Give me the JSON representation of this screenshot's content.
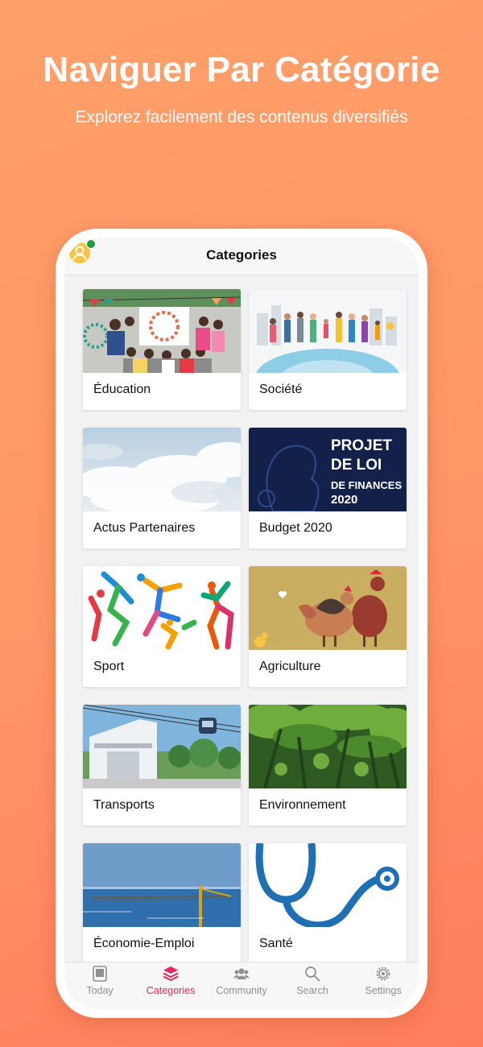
{
  "hero": {
    "title": "Naviguer Par Catégorie",
    "subtitle": "Explorez facilement des contenus diversifiés"
  },
  "navbar": {
    "title": "Categories",
    "avatar_icon": "user-avatar-icon",
    "status": "online"
  },
  "categories": [
    {
      "label": "Éducation",
      "image": "education-photo"
    },
    {
      "label": "Société",
      "image": "society-illustration"
    },
    {
      "label": "Actus Partenaires",
      "image": "sky-clouds-photo"
    },
    {
      "label": "Budget 2020",
      "image": "budget-cover",
      "image_text": [
        "PROJET",
        "DE LOI",
        "DE FINANCES",
        "2020"
      ]
    },
    {
      "label": "Sport",
      "image": "sport-illustration"
    },
    {
      "label": "Agriculture",
      "image": "chickens-illustration"
    },
    {
      "label": "Transports",
      "image": "cable-car-photo"
    },
    {
      "label": "Environnement",
      "image": "forest-photo"
    },
    {
      "label": "Économie-Emploi",
      "image": "sea-crane-photo"
    },
    {
      "label": "Santé",
      "image": "stethoscope-illustration"
    }
  ],
  "tabs": [
    {
      "label": "Today",
      "icon": "today-icon",
      "active": false
    },
    {
      "label": "Categories",
      "icon": "layers-icon",
      "active": true
    },
    {
      "label": "Community",
      "icon": "people-icon",
      "active": false
    },
    {
      "label": "Search",
      "icon": "search-icon",
      "active": false
    },
    {
      "label": "Settings",
      "icon": "gear-icon",
      "active": false
    }
  ],
  "colors": {
    "background": "#ff9566",
    "active_tab": "#e8265a",
    "inactive_tab": "#8e8e93",
    "status_dot": "#1e9b3a"
  }
}
